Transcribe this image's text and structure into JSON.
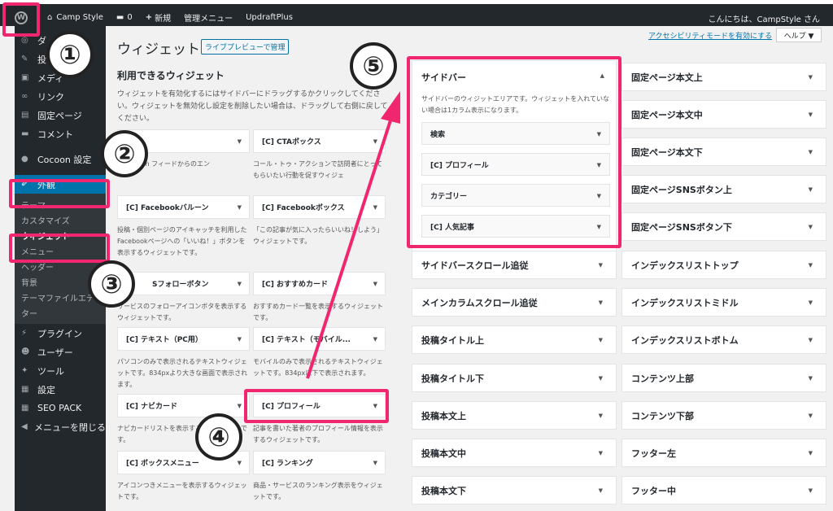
{
  "adminbar": {
    "site_name": "Camp Style",
    "comments_count": "0",
    "new_label": "新規",
    "admin_menu_label": "管理メニュー",
    "plugin_label": "UpdraftPlus",
    "greeting": "こんにちは、CampStyle さん"
  },
  "sidebar": {
    "items": [
      {
        "label": "ダ",
        "icon": "dashboard-icon"
      },
      {
        "label": "投",
        "icon": "pin-icon"
      },
      {
        "label": "メディ",
        "icon": "media-icon"
      },
      {
        "label": "リンク",
        "icon": "link-icon"
      },
      {
        "label": "固定ページ",
        "icon": "page-icon"
      },
      {
        "label": "コメント",
        "icon": "comment-icon"
      },
      {
        "label": "Cocoon 設定",
        "icon": "cocoon-icon"
      },
      {
        "label": "外観",
        "icon": "brush-icon"
      }
    ],
    "sub_items": [
      "テーマ",
      "カスタマイズ",
      "ウィジェット",
      "メニュー",
      "ヘッダー",
      "背景",
      "テーマファイルエディ",
      "ター"
    ],
    "bottom_items": [
      {
        "label": "プラグイン",
        "icon": "plugin-icon"
      },
      {
        "label": "ユーザー",
        "icon": "user-icon"
      },
      {
        "label": "ツール",
        "icon": "wrench-icon"
      },
      {
        "label": "設定",
        "icon": "settings-icon"
      },
      {
        "label": "SEO PACK",
        "icon": "seo-icon"
      },
      {
        "label": "メニューを閉じる",
        "icon": "collapse-icon"
      }
    ]
  },
  "header": {
    "title": "ウィジェット",
    "live_preview": "ライブプレビューで管理",
    "a11y_link": "アクセシビリティモードを有効にする",
    "help": "ヘルプ ▼"
  },
  "available": {
    "title": "利用できるウィジェット",
    "desc": "ウィジェットを有効化するにはサイドバーにドラッグするかクリックしてくださ い。ウィジェットを無効化し設定を削除したい場合は、ドラッグして右側に戻してください。",
    "widgets": [
      {
        "label": "",
        "desc": "RSS/Atom フィードからのエン"
      },
      {
        "label": "[C] CTAボックス",
        "desc": "コール・トゥ・アクションで訪問者にとってもらいたい行動を促すウィジェ"
      },
      {
        "label": "[C] Facebookバルーン",
        "desc": "投稿・個別ページのアイキャッチを利用したFacebookページへの「いいね！」ボタンを表示するウィジェットです。"
      },
      {
        "label": "[C] Facebookボックス",
        "desc": "「この記事が気に入ったらいいね！しよう」ウィジェットです。"
      },
      {
        "label": "Sフォローボタン",
        "desc": "サービスのフォローアイコンボタを表示するウィジェットです。"
      },
      {
        "label": "[C] おすすめカード",
        "desc": "おすすめカード一覧を表示するウィジェットです。"
      },
      {
        "label": "[C] テキスト（PC用）",
        "desc": "パソコンのみで表示されるテキストウィジェットです。834pxより大きな画面で表示されます。"
      },
      {
        "label": "[C] テキスト（モバイル...",
        "desc": "モバイルのみで表示されるテキストウィジェットです。834px以下で表示されます。"
      },
      {
        "label": "[C] ナビカード",
        "desc": "ナビカードリストを表示するウィジェットです。"
      },
      {
        "label": "[C] プロフィール",
        "desc": "記事を書いた著者のプロフィール情報を表示するウィジェットです。"
      },
      {
        "label": "[C] ボックスメニュー",
        "desc": "アイコンつきメニューを表示するウィジェットです。"
      },
      {
        "label": "[C] ランキング",
        "desc": "商品・サービスのランキング表示をウィジェットです。"
      }
    ]
  },
  "sidebar_area": {
    "title": "サイドバー",
    "desc": "サイドバーのウィジットエリアです。ウィジェットを入れていない場合は1カラム表示になります。",
    "widgets": [
      "検索",
      "[C] プロフィール",
      "カテゴリー",
      "[C] 人気記事"
    ]
  },
  "areas_left": [
    "サイドバースクロール追従",
    "メインカラムスクロール追従",
    "投稿タイトル上",
    "投稿タイトル下",
    "投稿本文上",
    "投稿本文中",
    "投稿本文下"
  ],
  "areas_right": [
    "固定ページ本文上",
    "固定ページ本文中",
    "固定ページ本文下",
    "固定ページSNSボタン上",
    "固定ページSNSボタン下",
    "インデックスリストトップ",
    "インデックスリストミドル",
    "インデックスリストボトム",
    "コンテンツ上部",
    "コンテンツ下部",
    "フッター左",
    "フッター中"
  ],
  "annotations": [
    "①",
    "②",
    "③",
    "④",
    "⑤"
  ],
  "colors": {
    "highlight": "#f0266f",
    "adminbar": "#23282d",
    "active": "#0073aa"
  }
}
